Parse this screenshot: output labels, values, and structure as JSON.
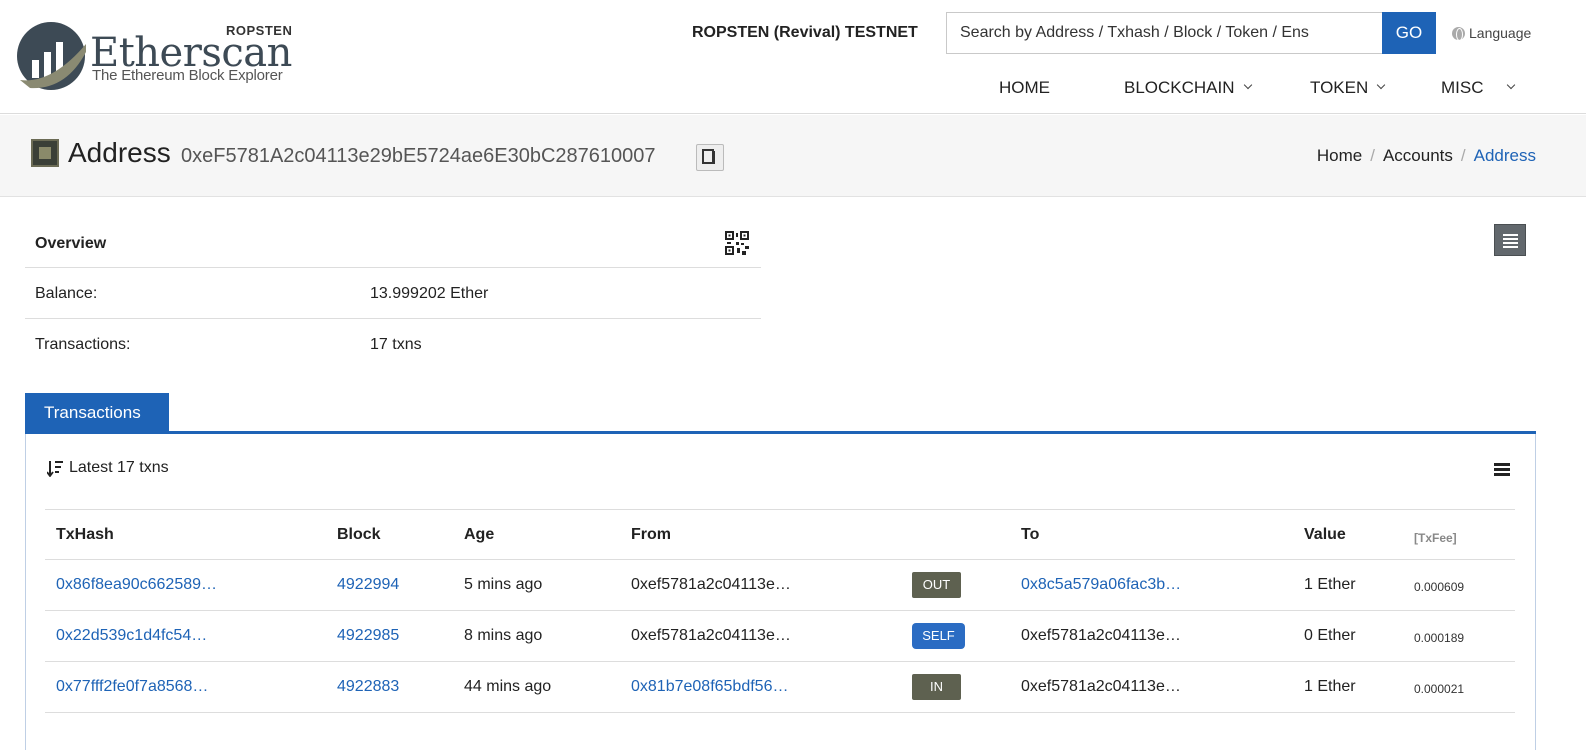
{
  "header": {
    "logo_network": "ROPSTEN",
    "logo_name": "Etherscan",
    "logo_tagline": "The Ethereum Block Explorer",
    "network": "ROPSTEN (Revival) TESTNET",
    "search_placeholder": "Search by Address / Txhash / Block / Token / Ens",
    "go_label": "GO",
    "language_label": "Language",
    "nav": [
      {
        "label": "HOME"
      },
      {
        "label": "BLOCKCHAIN"
      },
      {
        "label": "TOKEN"
      },
      {
        "label": "MISC"
      }
    ]
  },
  "title": {
    "page_title": "Address",
    "address": "0xeF5781A2c04113e29bE5724ae6E30bC287610007",
    "breadcrumb": [
      "Home",
      "Accounts",
      "Address"
    ]
  },
  "overview": {
    "heading": "Overview",
    "rows": [
      {
        "label": "Balance:",
        "value": "13.999202 Ether"
      },
      {
        "label": "Transactions:",
        "value": "17 txns"
      }
    ]
  },
  "tabs": {
    "transactions": "Transactions"
  },
  "transactions": {
    "summary": "Latest 17 txns",
    "columns": {
      "txhash": "TxHash",
      "block": "Block",
      "age": "Age",
      "from": "From",
      "to": "To",
      "value": "Value",
      "fee": "[TxFee]"
    },
    "rows": [
      {
        "txhash": "0x86f8ea90c662589…",
        "block": "4922994",
        "age": "5 mins ago",
        "from": "0xef5781a2c04113e…",
        "direction": "OUT",
        "to": "0x8c5a579a06fac3b…",
        "value": "1 Ether",
        "fee": "0.000609"
      },
      {
        "txhash": "0x22d539c1d4fc54…",
        "block": "4922985",
        "age": "8 mins ago",
        "from": "0xef5781a2c04113e…",
        "direction": "SELF",
        "to": "0xef5781a2c04113e…",
        "value": "0 Ether",
        "fee": "0.000189"
      },
      {
        "txhash": "0x77fff2fe0f7a8568…",
        "block": "4922883",
        "age": "44 mins ago",
        "from": "0x81b7e08f65bdf56…",
        "direction": "IN",
        "to": "0xef5781a2c04113e…",
        "value": "1 Ether",
        "fee": "0.000021"
      }
    ]
  },
  "colors": {
    "accent": "#1e63b6",
    "badge_out": "#5e6150",
    "badge_self": "#2b6cc3",
    "badge_in": "#5e6150"
  }
}
